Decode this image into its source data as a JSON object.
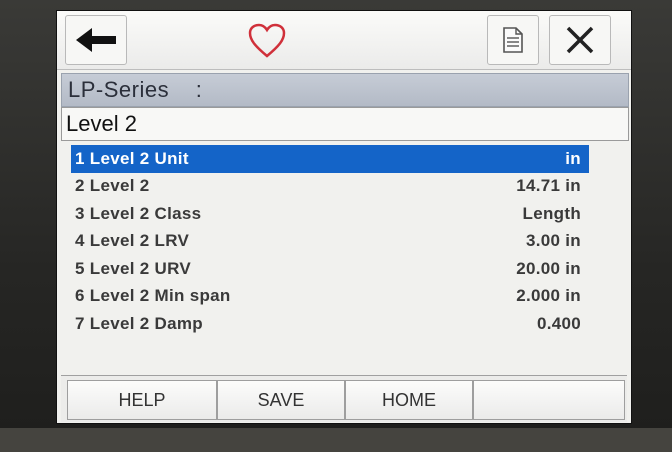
{
  "toolbar": {
    "back_icon": "arrow-left-icon",
    "favorite_icon": "heart-icon",
    "document_icon": "document-icon",
    "close_icon": "close-icon"
  },
  "device": {
    "name": "LP-Series",
    "separator": ":"
  },
  "menu": {
    "title": "Level 2",
    "items": [
      {
        "label": "1 Level 2 Unit",
        "value": "in"
      },
      {
        "label": "2 Level 2",
        "value": "14.71 in"
      },
      {
        "label": "3 Level 2 Class",
        "value": "Length"
      },
      {
        "label": "4 Level 2 LRV",
        "value": "3.00 in"
      },
      {
        "label": "5 Level 2 URV",
        "value": "20.00 in"
      },
      {
        "label": "6 Level 2 Min span",
        "value": "2.000 in"
      },
      {
        "label": "7 Level 2 Damp",
        "value": "0.400"
      }
    ]
  },
  "footer": {
    "help_label": "HELP",
    "save_label": "SAVE",
    "home_label": "HOME",
    "blank_label": ""
  },
  "colors": {
    "selection": "#1464c8",
    "heart": "#d0303a",
    "device_bar": "#b3bac6"
  }
}
